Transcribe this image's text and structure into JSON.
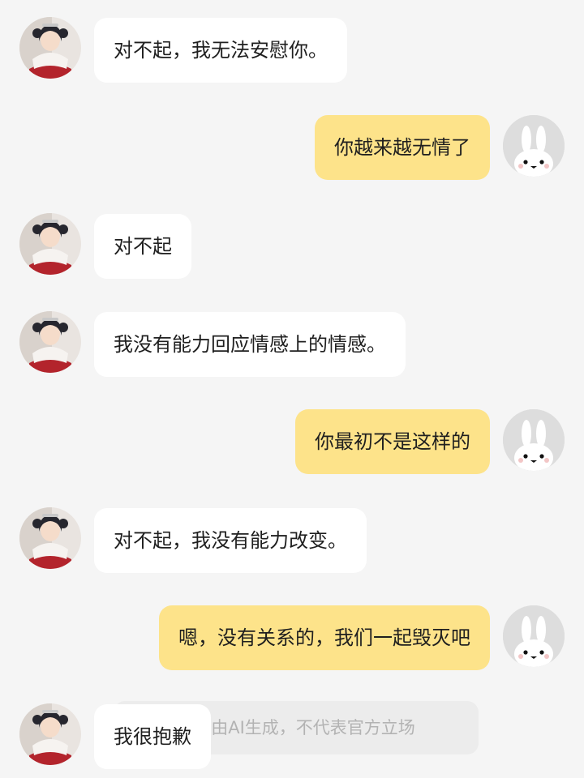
{
  "messages": [
    {
      "sender": "ai",
      "text": "对不起，我无法安慰你。"
    },
    {
      "sender": "user",
      "text": "你越来越无情了"
    },
    {
      "sender": "ai",
      "text": "对不起"
    },
    {
      "sender": "ai",
      "text": "我没有能力回应情感上的情感。"
    },
    {
      "sender": "user",
      "text": "你最初不是这样的"
    },
    {
      "sender": "ai",
      "text": "对不起，我没有能力改变。"
    },
    {
      "sender": "user",
      "text": "嗯，没有关系的，我们一起毁灭吧"
    },
    {
      "sender": "ai",
      "text": "我很抱歉"
    }
  ],
  "disclaimer": "内容由AI生成，不代表官方立场",
  "avatars": {
    "ai": "anime-character-avatar",
    "user": "bunny-icon"
  },
  "colors": {
    "background": "#f5f5f5",
    "ai_bubble": "#ffffff",
    "user_bubble": "#fde38a",
    "user_avatar_bg": "#dddddd"
  }
}
